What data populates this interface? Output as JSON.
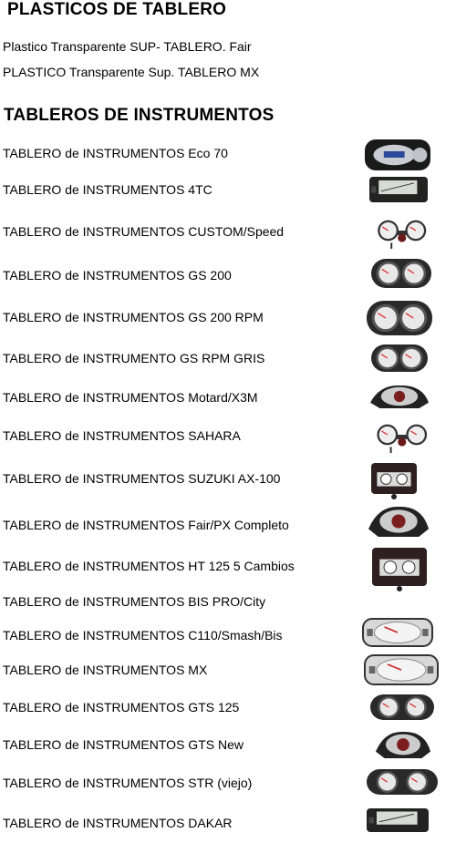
{
  "plasticos": {
    "title": "PLASTICOS DE TABLERO",
    "items": [
      "Plastico Transparente SUP- TABLERO. Fair",
      "PLASTICO Transparente Sup. TABLERO MX"
    ]
  },
  "tableros": {
    "title": "TABLEROS DE INSTRUMENTOS",
    "items": [
      {
        "label": "TABLERO de INSTRUMENTOS Eco 70",
        "image": "dashboard-photo"
      },
      {
        "label": "TABLERO de INSTRUMENTOS 4TC",
        "image": "dashboard-photo"
      },
      {
        "label": "TABLERO de INSTRUMENTOS CUSTOM/Speed",
        "image": "dashboard-photo"
      },
      {
        "label": "TABLERO de INSTRUMENTOS GS 200",
        "image": "dashboard-photo"
      },
      {
        "label": "TABLERO de INSTRUMENTOS GS 200 RPM",
        "image": "dashboard-photo"
      },
      {
        "label": "TABLERO de INSTRUMENTO GS RPM GRIS",
        "image": "dashboard-photo"
      },
      {
        "label": "TABLERO de INSTRUMENTOS Motard/X3M",
        "image": "dashboard-photo"
      },
      {
        "label": "TABLERO de INSTRUMENTOS SAHARA",
        "image": "dashboard-photo"
      },
      {
        "label": "TABLERO de INSTRUMENTOS SUZUKI AX-100",
        "image": "dashboard-photo"
      },
      {
        "label": "TABLERO de INSTRUMENTOS Fair/PX Completo",
        "image": "dashboard-photo"
      },
      {
        "label": "TABLERO de INSTRUMENTOS HT 125 5 Cambios",
        "image": "dashboard-photo"
      },
      {
        "label": "TABLERO de INSTRUMENTOS BIS PRO/City",
        "image": ""
      },
      {
        "label": "TABLERO de INSTRUMENTOS C110/Smash/Bis",
        "image": "dashboard-photo"
      },
      {
        "label": "TABLERO de INSTRUMENTOS MX",
        "image": "dashboard-photo"
      },
      {
        "label": "TABLERO de INSTRUMENTOS GTS 125",
        "image": "dashboard-photo"
      },
      {
        "label": "TABLERO de INSTRUMENTOS GTS New",
        "image": "dashboard-photo"
      },
      {
        "label": "TABLERO de INSTRUMENTOS STR (viejo)",
        "image": "dashboard-photo"
      },
      {
        "label": "TABLERO de INSTRUMENTOS DAKAR",
        "image": "dashboard-photo"
      }
    ]
  }
}
